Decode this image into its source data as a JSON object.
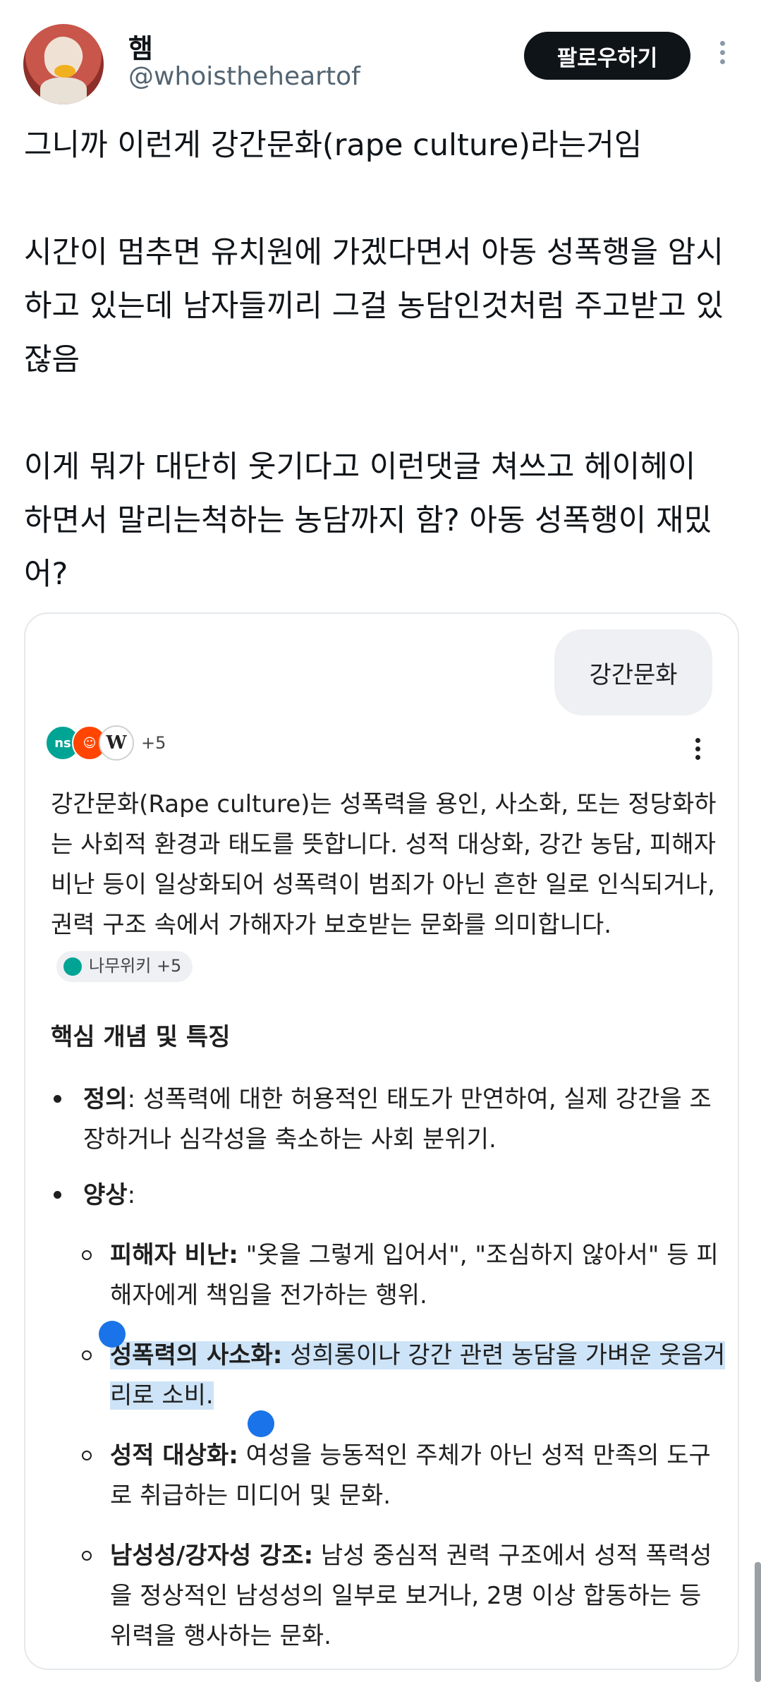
{
  "tweet": {
    "author_name": "햄",
    "author_handle": "@whoistheheartof",
    "follow_label": "팔로우하기",
    "more_icon": "more-vertical-icon",
    "paragraphs": [
      "그니까 이런게 강간문화(rape culture)라는거임",
      "시간이 멈추면 유치원에 가겠다면서 아동 성폭행을 암시하고 있는데 남자들끼리 그걸 농담인것처럼 주고받고 있잖음",
      "이게 뭐가 대단히 웃기다고 이런댓글 쳐쓰고 헤이헤이 하면서 말리는척하는 농담까지 함? 아동 성폭행이 재밌어?"
    ]
  },
  "ai_card": {
    "query": "강간문화",
    "sources_count": "+5",
    "intro": "강간문화(Rape culture)는 성폭력을 용인, 사소화, 또는 정당화하는 사회적 환경과 태도를 뜻합니다. 성적 대상화, 강간 농담, 피해자 비난 등이 일상화되어 성폭력이 범죄가 아닌 흔한 일로 인식되거나, 권력 구조 속에서 가해자가 보호받는 문화를 의미합니다.",
    "citation_chip": "나무위키 +5",
    "section_title": "핵심 개념 및 특징",
    "definition_label": "정의",
    "definition_text": ": 성폭력에 대한 허용적인 태도가 만연하여, 실제 강간을 조장하거나 심각성을 축소하는 사회 분위기.",
    "aspects_label": "양상",
    "aspects_colon": ":",
    "aspects": [
      {
        "label": "피해자 비난:",
        "text": " \"옷을 그렇게 입어서\", \"조심하지 않아서\" 등 피해자에게 책임을 전가하는 행위."
      },
      {
        "label": "성폭력의 사소화:",
        "text": " 성희롱이나 강간 관련 농담을 가벼운 웃음거리로 소비."
      },
      {
        "label": "성적 대상화:",
        "text": " 여성을 능동적인 주체가 아닌 성적 만족의 도구로 취급하는 미디어 및 문화."
      },
      {
        "label": "남성성/강자성 강조:",
        "text": " 남성 중심적 권력 구조에서 성적 폭력성을 정상적인 남성성의 일부로 보거나, 2명 이상 합동하는 등 위력을 행사하는 문화."
      }
    ]
  },
  "colors": {
    "selection": "#cde3f7",
    "handle": "#1a73e8",
    "follow_bg": "#0f1419"
  }
}
